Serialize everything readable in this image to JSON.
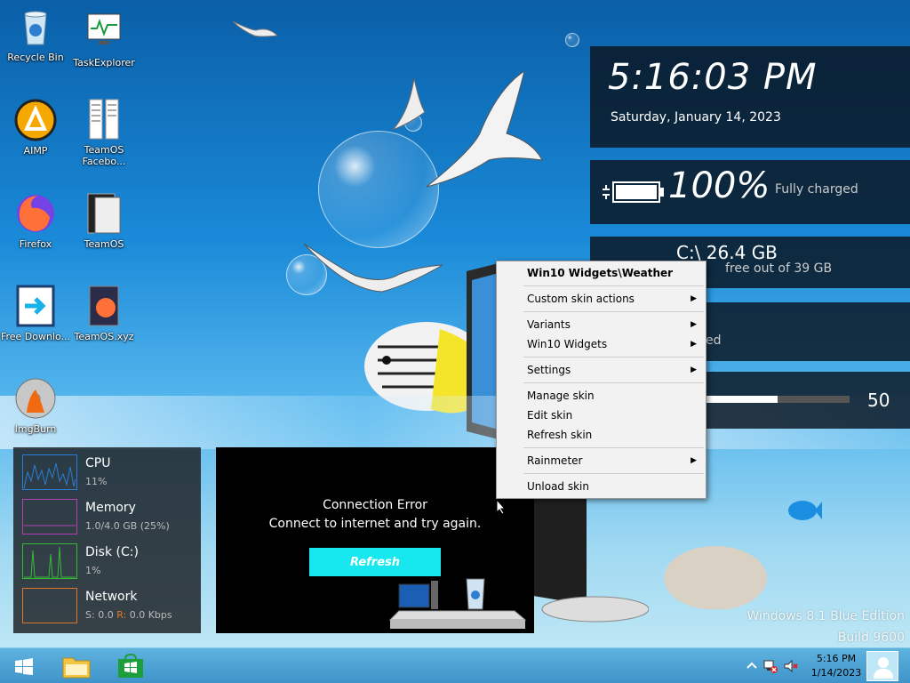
{
  "desktop": {
    "icons": [
      {
        "label": "Recycle Bin"
      },
      {
        "label": "TaskExplorer"
      },
      {
        "label": "AIMP"
      },
      {
        "label": "TeamOS Facebo..."
      },
      {
        "label": "Firefox"
      },
      {
        "label": "TeamOS"
      },
      {
        "label": "Free Downlo..."
      },
      {
        "label": "TeamOS.xyz"
      },
      {
        "label": "ImgBurn"
      }
    ],
    "watermark": {
      "edition": "Windows 8.1 Blue Edition",
      "build": "Build 9600"
    }
  },
  "clock_widget": {
    "time": "5:16:03 PM",
    "date": "Saturday, January 14, 2023"
  },
  "battery_widget": {
    "percent": "100%",
    "status": "Fully charged",
    "level": 1.0
  },
  "disk_widget": {
    "drive": "C:\\ 26.4 GB",
    "free_text": "free out of 39 GB"
  },
  "partial_widget": {
    "text": "ed"
  },
  "volume_widget": {
    "value": "50",
    "level": 0.5
  },
  "context_menu": {
    "title": "Win10 Widgets\\Weather",
    "items": [
      {
        "label": "Custom skin actions",
        "submenu": true
      },
      {
        "label": "Variants",
        "submenu": true
      },
      {
        "label": "Win10 Widgets",
        "submenu": true
      },
      {
        "label": "Settings",
        "submenu": true
      },
      {
        "label": "Manage skin",
        "submenu": false
      },
      {
        "label": "Edit skin",
        "submenu": false
      },
      {
        "label": "Refresh skin",
        "submenu": false
      },
      {
        "label": "Rainmeter",
        "submenu": true
      },
      {
        "label": "Unload skin",
        "submenu": false
      }
    ],
    "arrow": "▶"
  },
  "sysmon": {
    "cpu": {
      "name": "CPU",
      "value": "11%",
      "color": "#2a7fd4"
    },
    "memory": {
      "name": "Memory",
      "value": "1.0/4.0 GB (25%)",
      "color": "#b43fb4"
    },
    "disk": {
      "name": "Disk (C:)",
      "value": "1%",
      "color": "#38b838"
    },
    "network": {
      "name": "Network",
      "value_s_label": "S:",
      "value_s": "0.0",
      "value_r_label": "R:",
      "value_r": "0.0 Kbps",
      "color": "#e0782a"
    }
  },
  "weather_widget": {
    "error_title": "Connection Error",
    "error_message": "Connect to internet and try again.",
    "refresh_label": "Refresh"
  },
  "taskbar": {
    "clock_time": "5:16 PM",
    "clock_date": "1/14/2023"
  },
  "colors": {
    "accent_cyan": "#17e8f0",
    "taskbar": "#4aa3d6"
  }
}
